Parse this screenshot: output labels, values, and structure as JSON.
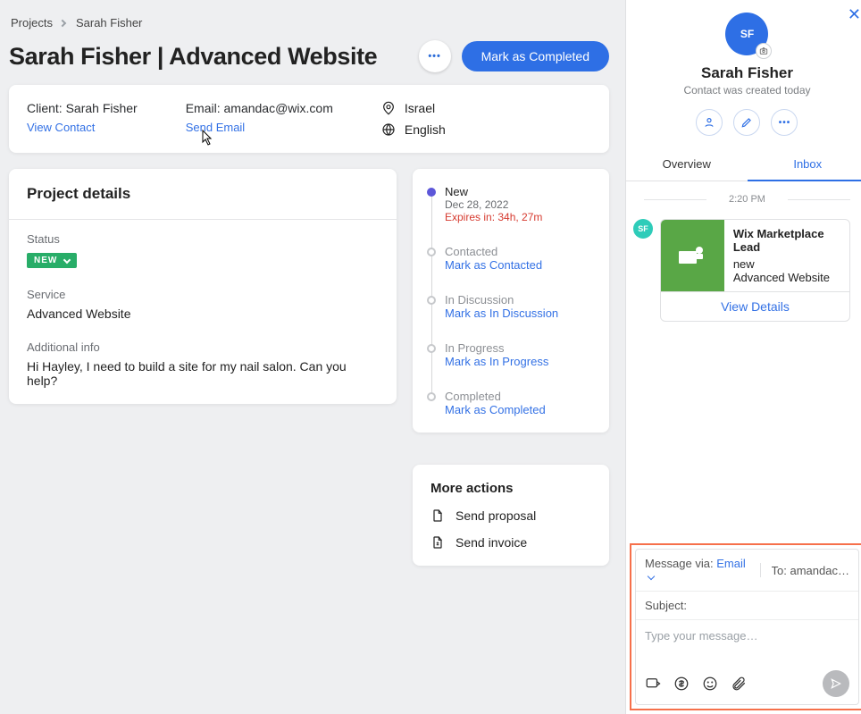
{
  "crumbs": {
    "root": "Projects",
    "current": "Sarah Fisher"
  },
  "header": {
    "title": "Sarah Fisher | Advanced Website",
    "complete_btn": "Mark as Completed"
  },
  "info": {
    "client_label": "Client: Sarah Fisher",
    "view_contact": "View Contact",
    "email_label": "Email: amandac@wix.com",
    "send_email": "Send Email",
    "location": "Israel",
    "language": "English"
  },
  "details": {
    "heading": "Project details",
    "status_label": "Status",
    "status_value": "NEW",
    "service_label": "Service",
    "service_value": "Advanced Website",
    "additional_label": "Additional info",
    "additional_value": "Hi Hayley, I need to build a site for my nail salon. Can you help?"
  },
  "timeline": [
    {
      "title": "New",
      "active": true,
      "date": "Dec 28, 2022",
      "expires": "Expires in: 34h, 27m"
    },
    {
      "title": "Contacted",
      "action": "Mark as Contacted"
    },
    {
      "title": "In Discussion",
      "action": "Mark as In Discussion"
    },
    {
      "title": "In Progress",
      "action": "Mark as In Progress"
    },
    {
      "title": "Completed",
      "action": "Mark as Completed"
    }
  ],
  "more": {
    "heading": "More actions",
    "send_proposal": "Send proposal",
    "send_invoice": "Send invoice"
  },
  "side": {
    "avatar_initials": "SF",
    "name": "Sarah Fisher",
    "subtitle": "Contact was created today",
    "tab_overview": "Overview",
    "tab_inbox": "Inbox",
    "timestamp": "2:20 PM",
    "msg_initials": "SF",
    "msg_title": "Wix Marketplace Lead",
    "msg_sub1": "new",
    "msg_sub2": "Advanced Website",
    "view_details": "View Details"
  },
  "composer": {
    "via_label": "Message via:",
    "via_value": "Email",
    "to_label": "To:",
    "to_value": "amandac…",
    "subject_label": "Subject:",
    "placeholder": "Type your message…"
  }
}
